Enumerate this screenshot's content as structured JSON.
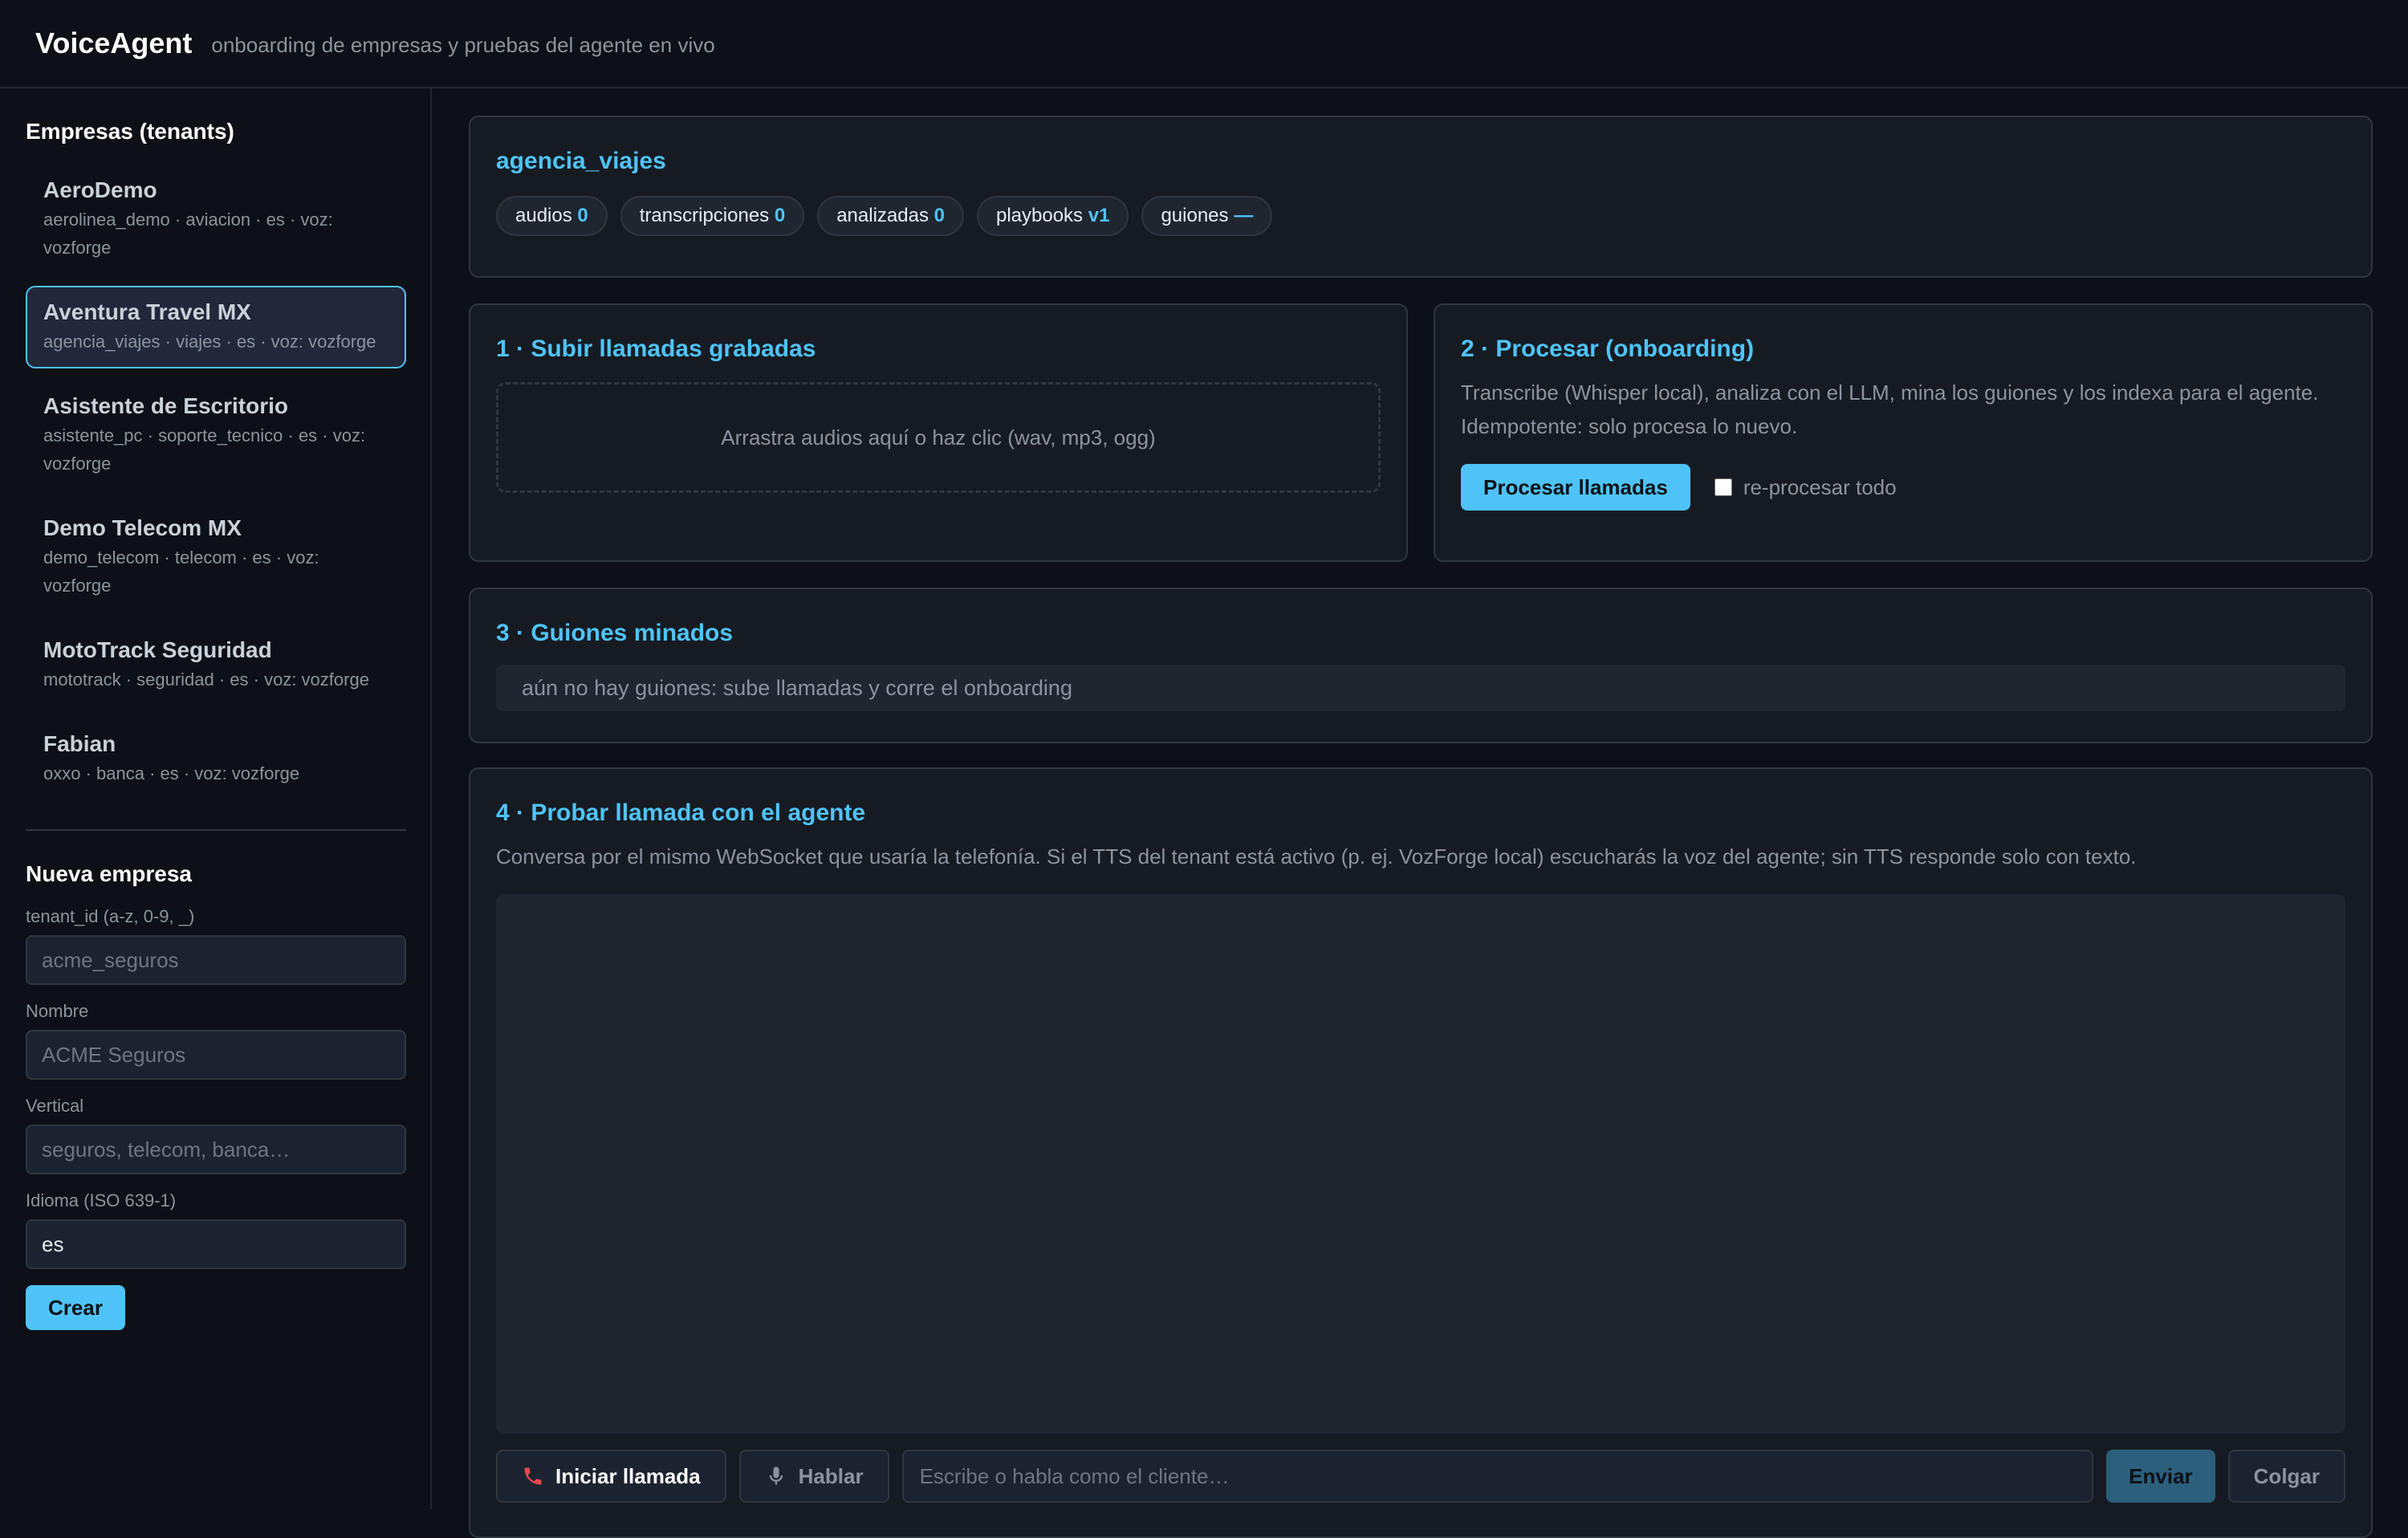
{
  "header": {
    "brand": "VoiceAgent",
    "subtitle": "onboarding de empresas y pruebas del agente en vivo"
  },
  "sidebar": {
    "title": "Empresas (tenants)",
    "tenants": [
      {
        "name": "AeroDemo",
        "meta": "aerolinea_demo · aviacion · es · voz: vozforge"
      },
      {
        "name": "Aventura Travel MX",
        "meta": "agencia_viajes · viajes · es · voz: vozforge",
        "active": true
      },
      {
        "name": "Asistente de Escritorio",
        "meta": "asistente_pc · soporte_tecnico · es · voz: vozforge"
      },
      {
        "name": "Demo Telecom MX",
        "meta": "demo_telecom · telecom · es · voz: vozforge"
      },
      {
        "name": "MotoTrack Seguridad",
        "meta": "mototrack · seguridad · es · voz: vozforge"
      },
      {
        "name": "Fabian",
        "meta": "oxxo · banca · es · voz: vozforge"
      }
    ],
    "form": {
      "title": "Nueva empresa",
      "tenant_id_label": "tenant_id (a-z, 0-9, _)",
      "tenant_id_placeholder": "acme_seguros",
      "name_label": "Nombre",
      "name_placeholder": "ACME Seguros",
      "vertical_label": "Vertical",
      "vertical_placeholder": "seguros, telecom, banca…",
      "language_label": "Idioma (ISO 639-1)",
      "language_value": "es",
      "create_label": "Crear"
    }
  },
  "summary": {
    "tenant_id": "agencia_viajes",
    "chips": [
      {
        "label": "audios",
        "value": "0"
      },
      {
        "label": "transcripciones",
        "value": "0"
      },
      {
        "label": "analizadas",
        "value": "0"
      },
      {
        "label": "playbooks",
        "value": "v1"
      },
      {
        "label": "guiones",
        "value": "—"
      }
    ]
  },
  "upload": {
    "title": "1 · Subir llamadas grabadas",
    "dropzone": "Arrastra audios aquí o haz clic (wav, mp3, ogg)"
  },
  "process": {
    "title": "2 · Procesar (onboarding)",
    "description": "Transcribe (Whisper local), analiza con el LLM, mina los guiones y los indexa para el agente. Idempotente: solo procesa lo nuevo.",
    "button": "Procesar llamadas",
    "checkbox_label": "re-procesar todo",
    "checkbox_checked": false
  },
  "scripts": {
    "title": "3 · Guiones minados",
    "empty": "aún no hay guiones: sube llamadas y corre el onboarding"
  },
  "test": {
    "title": "4 · Probar llamada con el agente",
    "description": "Conversa por el mismo WebSocket que usaría la telefonía. Si el TTS del tenant está activo (p. ej. VozForge local) escucharás la voz del agente; sin TTS responde solo con texto.",
    "start_label": "Iniciar llamada",
    "talk_label": "Hablar",
    "input_placeholder": "Escribe o habla como el cliente…",
    "send_label": "Enviar",
    "hangup_label": "Colgar"
  },
  "icons": {
    "start": "phone-icon",
    "talk": "microphone-icon"
  },
  "colors": {
    "accent": "#4fc3f7",
    "background": "#0d1117",
    "card": "#161b22",
    "phone_icon": "#e5484d"
  }
}
